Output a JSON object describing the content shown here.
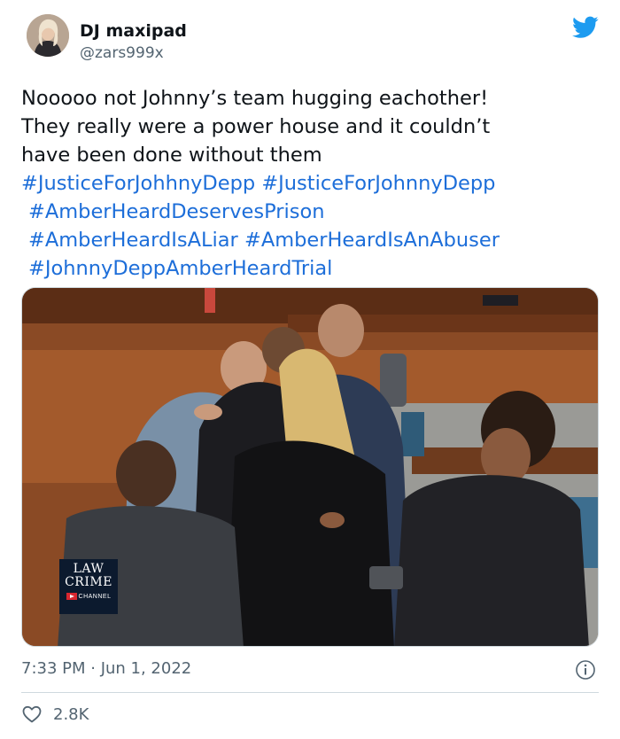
{
  "author": {
    "display_name": "DJ maxipad",
    "handle": "@zars999x",
    "avatar_icon": "avatar-photo"
  },
  "platform_icon": "twitter-bird-icon",
  "brand_color": "#1d9bf0",
  "hashtag_color": "#1d6ed9",
  "tweet": {
    "text_lines": [
      "Nooooo not Johnny’s team hugging eachother!",
      "They really were a power house and it couldn’t",
      "have been done without them"
    ],
    "hashtags": [
      "#JusticeForJohhnyDepp",
      "#JusticeForJohnnyDepp",
      "#AmberHeardDeservesPrison",
      "#AmberHeardIsALiar",
      "#AmberHeardIsAnAbuser",
      "#JohnnyDeppAmberHeardTrial"
    ]
  },
  "media": {
    "watermark": {
      "line1": "LAW",
      "line2": "CRIME",
      "line3": "CHANNEL"
    }
  },
  "meta": {
    "timestamp": "7:33 PM · Jun 1, 2022",
    "info_icon": "info-icon"
  },
  "engagement": {
    "like_icon": "heart-icon",
    "like_count": "2.8K"
  }
}
